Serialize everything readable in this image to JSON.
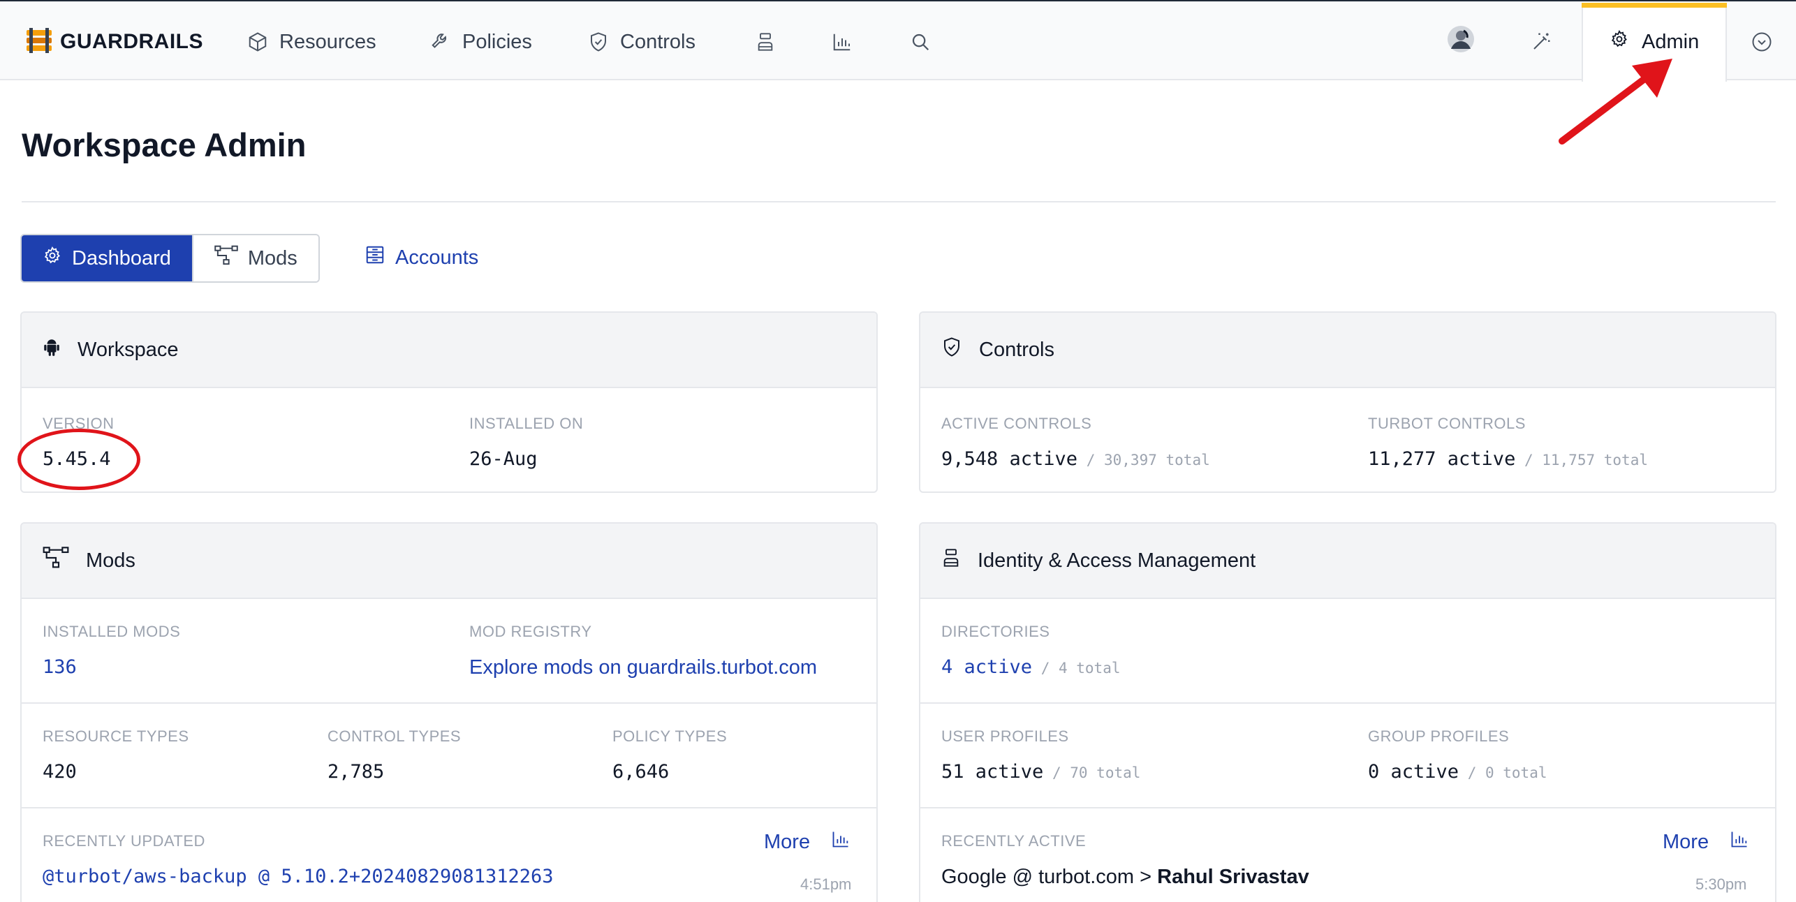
{
  "app": {
    "logo_text": "GUARDRAILS"
  },
  "nav": {
    "resources": "Resources",
    "policies": "Policies",
    "controls": "Controls",
    "admin": "Admin"
  },
  "page": {
    "title": "Workspace Admin"
  },
  "tabs": {
    "dashboard": "Dashboard",
    "mods": "Mods",
    "accounts": "Accounts"
  },
  "workspace": {
    "title": "Workspace",
    "version_label": "VERSION",
    "version": "5.45.4",
    "installed_label": "INSTALLED ON",
    "installed": "26-Aug"
  },
  "controls": {
    "title": "Controls",
    "active_label": "ACTIVE CONTROLS",
    "active_value": "9,548 active",
    "active_total": " / 30,397 total",
    "turbot_label": "TURBOT CONTROLS",
    "turbot_value": "11,277 active",
    "turbot_total": " / 11,757 total"
  },
  "mods": {
    "title": "Mods",
    "installed_label": "INSTALLED MODS",
    "installed_value": "136",
    "registry_label": "MOD REGISTRY",
    "registry_link": "Explore mods on guardrails.turbot.com",
    "resource_types_label": "RESOURCE TYPES",
    "resource_types": "420",
    "control_types_label": "CONTROL TYPES",
    "control_types": "2,785",
    "policy_types_label": "POLICY TYPES",
    "policy_types": "6,646",
    "recent_label": "RECENTLY UPDATED",
    "more": "More",
    "recent_item": "@turbot/aws-backup @ 5.10.2+20240829081312263",
    "recent_time": "4:51pm"
  },
  "iam": {
    "title": "Identity & Access Management",
    "directories_label": "DIRECTORIES",
    "directories_value": "4 active",
    "directories_total": " / 4 total",
    "user_label": "USER PROFILES",
    "user_value": "51 active",
    "user_total": " / 70 total",
    "group_label": "GROUP PROFILES",
    "group_value": "0 active",
    "group_total": " / 0 total",
    "recent_label": "RECENTLY ACTIVE",
    "more": "More",
    "recent_prefix": "Google @ turbot.com > ",
    "recent_name": "Rahul Srivastav",
    "recent_time": "5:30pm"
  },
  "colors": {
    "accent": "#1e40af",
    "tab_highlight": "#fbbf24",
    "annotation": "#e0141a"
  },
  "icons": [
    "logo-icon",
    "cube-icon",
    "wrench-icon",
    "shield-icon",
    "user-badge-icon",
    "chart-icon",
    "search-icon",
    "avatar",
    "magic-wand-icon",
    "gear-icon",
    "chevron-circle-icon",
    "android-icon",
    "mods-icon",
    "accounts-icon"
  ]
}
